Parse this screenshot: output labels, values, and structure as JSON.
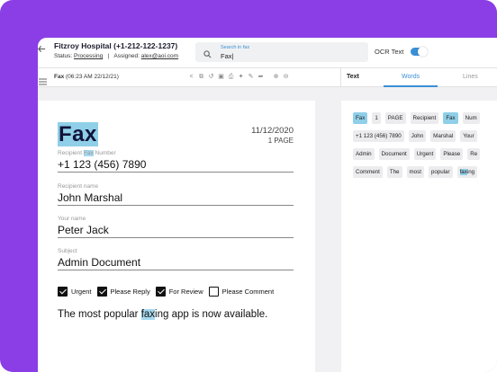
{
  "colors": {
    "frame": "#8b3ee6",
    "accent": "#3a8fd6",
    "highlight": "#8fcfe8"
  },
  "header": {
    "back_icon": "arrow-left-icon",
    "title": "Fitzroy Hospital (+1-212-122-1237)",
    "status_prefix": "Status:",
    "status_value": "Processing",
    "assigned_prefix": "Assigned:",
    "assigned_value": "alex@aoi.com"
  },
  "search": {
    "icon": "search-icon",
    "label": "Search in fax",
    "value": "Fax|"
  },
  "ocr": {
    "label": "OCR Text",
    "enabled": true
  },
  "toolbar": {
    "doc_name": "Fax",
    "doc_meta": "(06:23 AM  22/12/21)",
    "icons": [
      "share-icon",
      "copy-icon",
      "rotate-icon",
      "save-icon",
      "print-icon",
      "magic-icon",
      "edit-icon",
      "forward-icon",
      "zoom-in-icon",
      "zoom-out-icon"
    ]
  },
  "right_tabs": {
    "text": "Text",
    "words": "Words",
    "lines": "Lines"
  },
  "document": {
    "title": "Fax",
    "date": "11/12/2020",
    "pages": "1 PAGE",
    "recipient_fax_label_pre": "Recipient ",
    "recipient_fax_label_hl": "Fax",
    "recipient_fax_label_post": " Number",
    "recipient_fax_value": "+1 123 (456) 7890",
    "recipient_name_label": "Recipient name",
    "recipient_name_value": "John Marshal",
    "your_name_label": "Your name",
    "your_name_value": "Peter Jack",
    "subject_label": "Subject",
    "subject_value": "Admin Document",
    "checkboxes": [
      {
        "label": "Urgent",
        "checked": true
      },
      {
        "label": "Please Reply",
        "checked": true
      },
      {
        "label": "For Review",
        "checked": true
      },
      {
        "label": "Please Comment",
        "checked": false
      }
    ],
    "sentence_pre": "The most popular ",
    "sentence_hl": "fax",
    "sentence_post": "ing app is now available."
  },
  "words_panel": {
    "rows": [
      [
        "Fax",
        "1",
        "PAGE",
        "Recipient",
        "Fax",
        "Num"
      ],
      [
        "+1 123 (456) 7890",
        "John",
        "Marshal",
        "Your"
      ],
      [
        "Admin",
        "Document",
        "Urgent",
        "Please",
        "Re"
      ],
      [
        "Comment",
        "The",
        "most",
        "popular",
        "faxing"
      ]
    ]
  }
}
